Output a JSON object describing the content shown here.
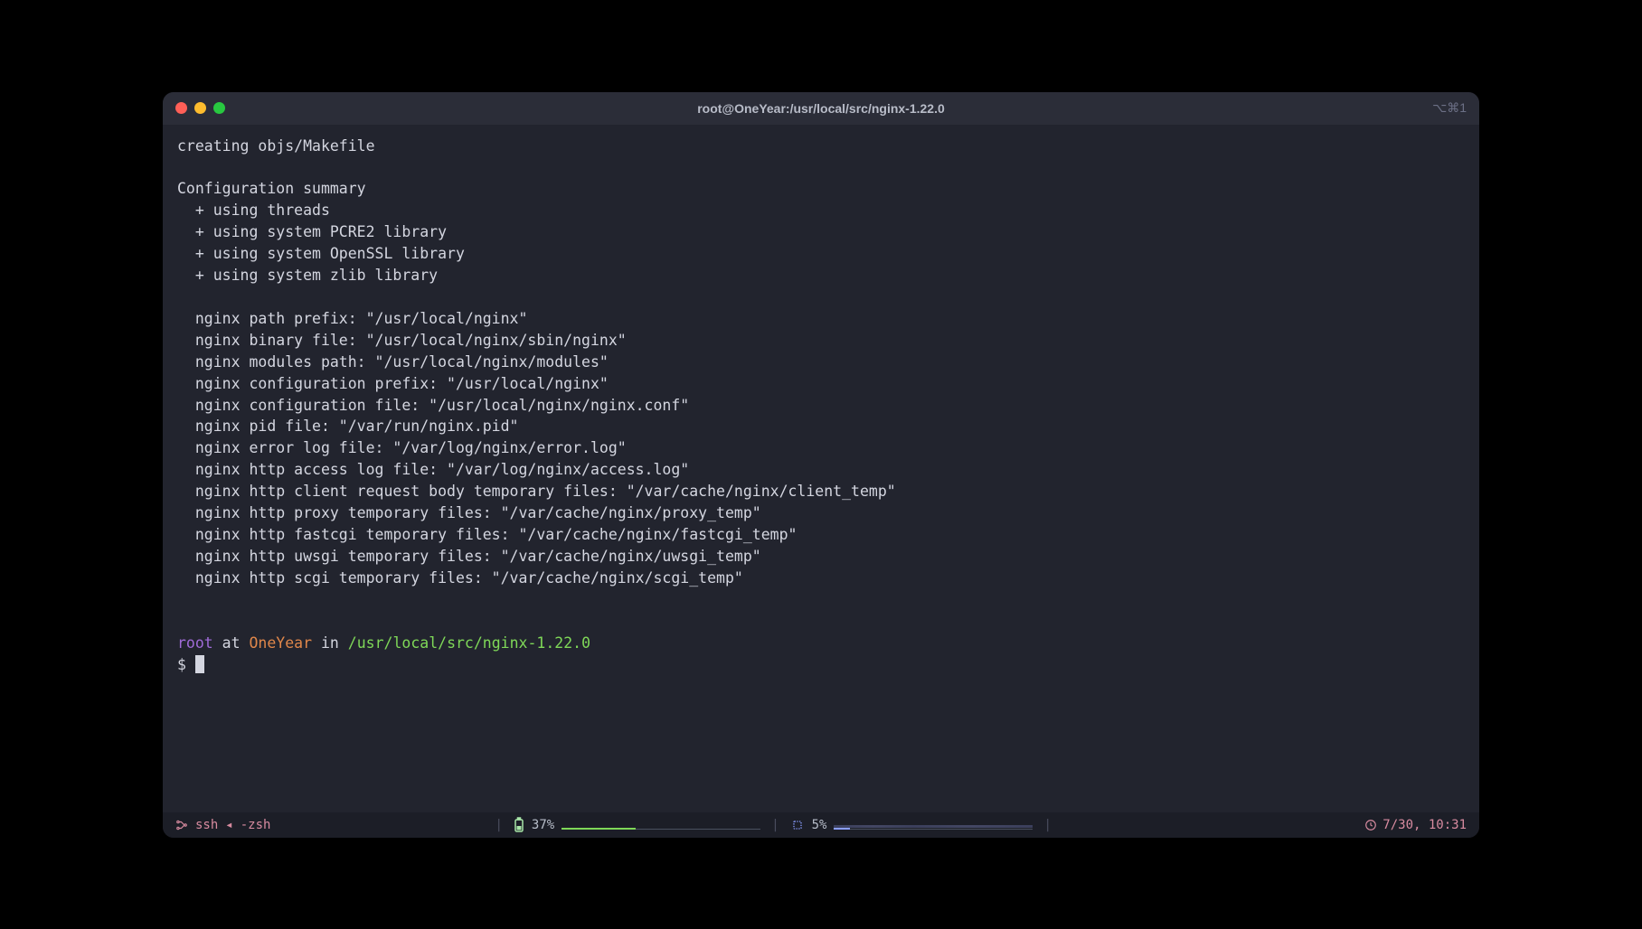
{
  "window": {
    "title": "root@OneYear:/usr/local/src/nginx-1.22.0",
    "hotkey": "⌥⌘1"
  },
  "output": {
    "line0": "creating objs/Makefile",
    "blank1": "",
    "summary_header": "Configuration summary",
    "summary": [
      "  + using threads",
      "  + using system PCRE2 library",
      "  + using system OpenSSL library",
      "  + using system zlib library"
    ],
    "blank2": "",
    "paths": [
      "  nginx path prefix: \"/usr/local/nginx\"",
      "  nginx binary file: \"/usr/local/nginx/sbin/nginx\"",
      "  nginx modules path: \"/usr/local/nginx/modules\"",
      "  nginx configuration prefix: \"/usr/local/nginx\"",
      "  nginx configuration file: \"/usr/local/nginx/nginx.conf\"",
      "  nginx pid file: \"/var/run/nginx.pid\"",
      "  nginx error log file: \"/var/log/nginx/error.log\"",
      "  nginx http access log file: \"/var/log/nginx/access.log\"",
      "  nginx http client request body temporary files: \"/var/cache/nginx/client_temp\"",
      "  nginx http proxy temporary files: \"/var/cache/nginx/proxy_temp\"",
      "  nginx http fastcgi temporary files: \"/var/cache/nginx/fastcgi_temp\"",
      "  nginx http uwsgi temporary files: \"/var/cache/nginx/uwsgi_temp\"",
      "  nginx http scgi temporary files: \"/var/cache/nginx/scgi_temp\""
    ]
  },
  "prompt": {
    "user": "root",
    "at": " at ",
    "host": "OneYear",
    "in": " in ",
    "path": "/usr/local/src/nginx-1.22.0",
    "symbol": "$ "
  },
  "status": {
    "ssh_label": "ssh",
    "arrow": "◂",
    "shell": "-zsh",
    "battery_pct": "37%",
    "cpu_pct": "5%",
    "clock": "7/30, 10:31"
  }
}
